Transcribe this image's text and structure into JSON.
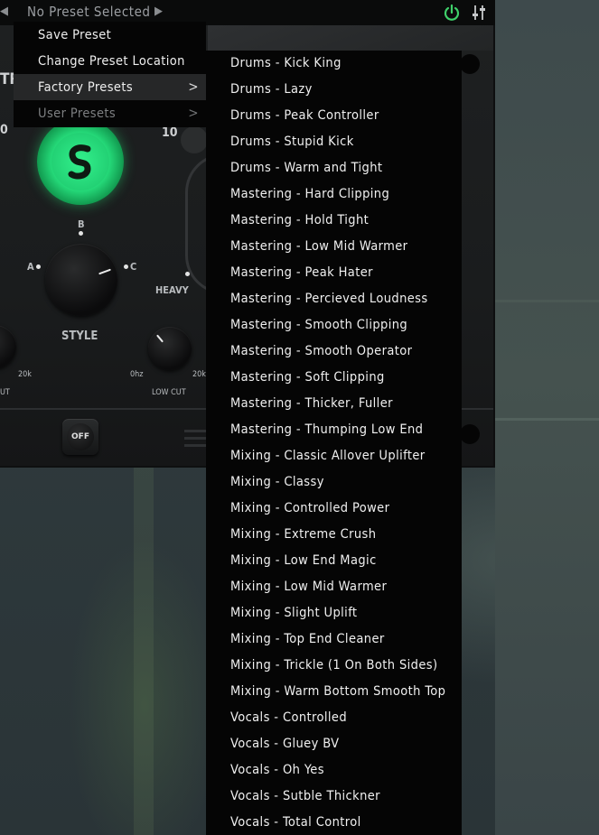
{
  "header": {
    "preset_name": "No Preset Selected",
    "prev_arrow": "◀",
    "next_arrow": "▶"
  },
  "colors": {
    "accent_green": "#27e07d",
    "power_green": "#3fd06a",
    "menu_bg": "#050505",
    "menu_highlight": "#262728"
  },
  "plugin": {
    "knob_labels": {
      "b": "B",
      "a": "A",
      "c": "C",
      "heavy": "HEAVY",
      "style": "STYLE",
      "ten": "10",
      "zero": "0",
      "hz20k": "20k",
      "hz0": "0hz",
      "hz20k_b": "20k",
      "low_cut": "LOW CUT",
      "ut": "UT",
      "tr": "TR"
    },
    "off_button": "OFF"
  },
  "menu": {
    "items": [
      {
        "label": "Save Preset"
      },
      {
        "label": "Change Preset Location"
      },
      {
        "label": "Factory Presets"
      },
      {
        "label": "User Presets"
      }
    ]
  },
  "factory_presets": [
    "Drums - Kick King",
    "Drums - Lazy",
    "Drums - Peak Controller",
    "Drums - Stupid Kick",
    "Drums - Warm and Tight",
    "Mastering - Hard Clipping",
    "Mastering - Hold Tight",
    "Mastering - Low Mid Warmer",
    "Mastering - Peak Hater",
    "Mastering - Percieved Loudness",
    "Mastering - Smooth Clipping",
    "Mastering - Smooth Operator",
    "Mastering - Soft Clipping",
    "Mastering - Thicker, Fuller",
    "Mastering - Thumping Low End",
    "Mixing - Classic Allover Uplifter",
    "Mixing - Classy",
    "Mixing - Controlled Power",
    "Mixing - Extreme Crush",
    "Mixing - Low End Magic",
    "Mixing - Low Mid Warmer",
    "Mixing - Slight Uplift",
    "Mixing - Top End Cleaner",
    "Mixing - Trickle (1 On Both Sides)",
    "Mixing - Warm Bottom Smooth Top",
    "Vocals - Controlled",
    "Vocals - Gluey BV",
    "Vocals - Oh Yes",
    "Vocals - Sutble Thickner",
    "Vocals - Total Control"
  ]
}
